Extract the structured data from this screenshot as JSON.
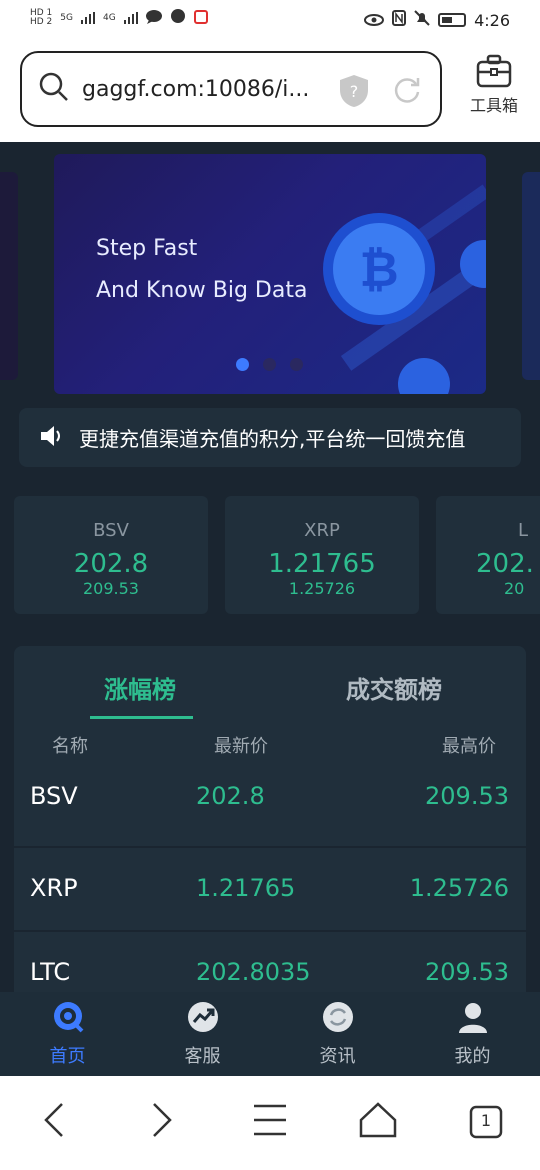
{
  "status_bar": {
    "sim1": "HD 1",
    "sim2": "HD 2",
    "net1": "5G",
    "net2": "4G",
    "time": "4:26"
  },
  "browser": {
    "url": "gaggf.com:10086/i...",
    "toolbox_label": "工具箱"
  },
  "banner": {
    "line1": "Step Fast",
    "line2": "And Know Big Data",
    "active_slide": 1,
    "slide_count": 3
  },
  "notice": {
    "text": "更捷充值渠道充值的积分,平台统一回馈充值"
  },
  "tickers": [
    {
      "name": "BSV",
      "price": "202.8",
      "high": "209.53"
    },
    {
      "name": "XRP",
      "price": "1.21765",
      "high": "1.25726"
    },
    {
      "name": "L",
      "price": "202.",
      "high": "20"
    }
  ],
  "rank": {
    "tabs": [
      "涨幅榜",
      "成交额榜"
    ],
    "active_tab": 0,
    "columns": [
      "名称",
      "最新价",
      "最高价"
    ],
    "rows": [
      {
        "name": "BSV",
        "price": "202.8",
        "high": "209.53"
      },
      {
        "name": "XRP",
        "price": "1.21765",
        "high": "1.25726"
      },
      {
        "name": "LTC",
        "price": "202.8035",
        "high": "209.53"
      }
    ]
  },
  "bottom_nav": [
    {
      "label": "首页",
      "icon": "home-icon",
      "active": true
    },
    {
      "label": "客服",
      "icon": "chart-trend-icon",
      "active": false
    },
    {
      "label": "资讯",
      "icon": "refresh-circle-icon",
      "active": false
    },
    {
      "label": "我的",
      "icon": "user-icon",
      "active": false
    }
  ],
  "system_nav": {
    "tab_count": "1"
  },
  "colors": {
    "accent_green": "#2ebd8f",
    "accent_blue": "#3d7bff",
    "background": "#1a2530",
    "card": "#202f3b"
  }
}
